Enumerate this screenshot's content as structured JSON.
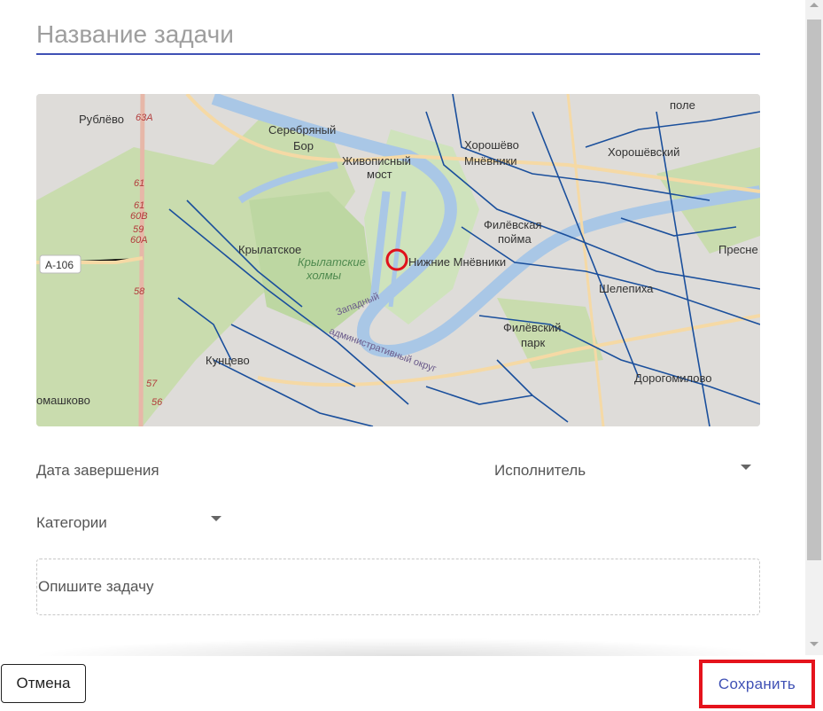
{
  "form": {
    "title_placeholder": "Название задачи",
    "due_date_label": "Дата завершения",
    "assignee_label": "Исполнитель",
    "categories_label": "Категории",
    "description_placeholder": "Опишите задачу"
  },
  "map": {
    "labels": {
      "rublevo": "Рублёво",
      "serebryany_bor": "Серебряный",
      "bor": "Бор",
      "zhivopisny": "Живописный",
      "most": "мост",
      "khoroshevo": "Хорошёво",
      "mnevniki": "Мнёвники",
      "khoroshevsky": "Хорошёвский",
      "pole": "поле",
      "filevskaya": "Филёвская",
      "poima": "пойма",
      "krylatskoe": "Крылатское",
      "krylatskie": "Крылатские",
      "kholmy": "холмы",
      "nizhnie_mnevniki": "Нижние Мнёвники",
      "shelepikha": "Шелепиха",
      "presnya": "Пресне",
      "filevsky": "Филёвский",
      "park": "парк",
      "kuntsevo": "Кунцево",
      "dorogomilovo": "Дорогомилово",
      "romashkovo": "омашково",
      "a106": "А-106",
      "zapadny": "Западный",
      "adm_okrug": "административный округ",
      "km_63a": "63А",
      "km_61a": "61",
      "km_61b": "61",
      "km_60v": "60В",
      "km_59": "59",
      "km_60a": "60А",
      "km_58": "58",
      "km_57": "57",
      "km_56": "56"
    },
    "colors": {
      "network": "#1a4f9c",
      "marker": "#e0111b",
      "forest": "#c9dcae",
      "water": "#a9c7e6",
      "urban": "#dedcd9"
    }
  },
  "footer": {
    "cancel_label": "Отмена",
    "save_label": "Сохранить"
  }
}
